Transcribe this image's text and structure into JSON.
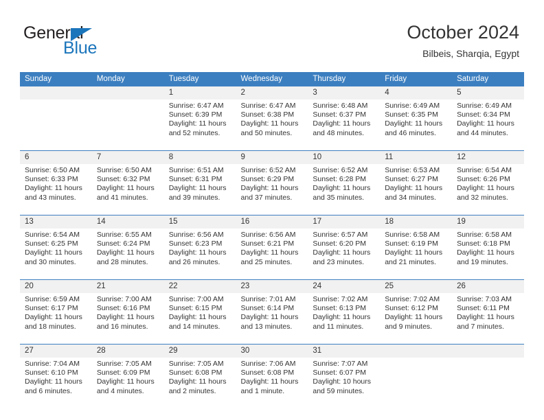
{
  "brand": {
    "name_top": "General",
    "name_bottom": "Blue",
    "flag_color": "#1b75bb"
  },
  "header": {
    "title": "October 2024",
    "location": "Bilbeis, Sharqia, Egypt",
    "header_bg": "#3c7fc0",
    "daynum_bg": "#f1f1f1"
  },
  "weekday_headers": [
    "Sunday",
    "Monday",
    "Tuesday",
    "Wednesday",
    "Thursday",
    "Friday",
    "Saturday"
  ],
  "weeks": [
    [
      {
        "day": "",
        "sunrise": "",
        "sunset": "",
        "daylight_l1": "",
        "daylight_l2": ""
      },
      {
        "day": "",
        "sunrise": "",
        "sunset": "",
        "daylight_l1": "",
        "daylight_l2": ""
      },
      {
        "day": "1",
        "sunrise": "Sunrise: 6:47 AM",
        "sunset": "Sunset: 6:39 PM",
        "daylight_l1": "Daylight: 11 hours",
        "daylight_l2": "and 52 minutes."
      },
      {
        "day": "2",
        "sunrise": "Sunrise: 6:47 AM",
        "sunset": "Sunset: 6:38 PM",
        "daylight_l1": "Daylight: 11 hours",
        "daylight_l2": "and 50 minutes."
      },
      {
        "day": "3",
        "sunrise": "Sunrise: 6:48 AM",
        "sunset": "Sunset: 6:37 PM",
        "daylight_l1": "Daylight: 11 hours",
        "daylight_l2": "and 48 minutes."
      },
      {
        "day": "4",
        "sunrise": "Sunrise: 6:49 AM",
        "sunset": "Sunset: 6:35 PM",
        "daylight_l1": "Daylight: 11 hours",
        "daylight_l2": "and 46 minutes."
      },
      {
        "day": "5",
        "sunrise": "Sunrise: 6:49 AM",
        "sunset": "Sunset: 6:34 PM",
        "daylight_l1": "Daylight: 11 hours",
        "daylight_l2": "and 44 minutes."
      }
    ],
    [
      {
        "day": "6",
        "sunrise": "Sunrise: 6:50 AM",
        "sunset": "Sunset: 6:33 PM",
        "daylight_l1": "Daylight: 11 hours",
        "daylight_l2": "and 43 minutes."
      },
      {
        "day": "7",
        "sunrise": "Sunrise: 6:50 AM",
        "sunset": "Sunset: 6:32 PM",
        "daylight_l1": "Daylight: 11 hours",
        "daylight_l2": "and 41 minutes."
      },
      {
        "day": "8",
        "sunrise": "Sunrise: 6:51 AM",
        "sunset": "Sunset: 6:31 PM",
        "daylight_l1": "Daylight: 11 hours",
        "daylight_l2": "and 39 minutes."
      },
      {
        "day": "9",
        "sunrise": "Sunrise: 6:52 AM",
        "sunset": "Sunset: 6:29 PM",
        "daylight_l1": "Daylight: 11 hours",
        "daylight_l2": "and 37 minutes."
      },
      {
        "day": "10",
        "sunrise": "Sunrise: 6:52 AM",
        "sunset": "Sunset: 6:28 PM",
        "daylight_l1": "Daylight: 11 hours",
        "daylight_l2": "and 35 minutes."
      },
      {
        "day": "11",
        "sunrise": "Sunrise: 6:53 AM",
        "sunset": "Sunset: 6:27 PM",
        "daylight_l1": "Daylight: 11 hours",
        "daylight_l2": "and 34 minutes."
      },
      {
        "day": "12",
        "sunrise": "Sunrise: 6:54 AM",
        "sunset": "Sunset: 6:26 PM",
        "daylight_l1": "Daylight: 11 hours",
        "daylight_l2": "and 32 minutes."
      }
    ],
    [
      {
        "day": "13",
        "sunrise": "Sunrise: 6:54 AM",
        "sunset": "Sunset: 6:25 PM",
        "daylight_l1": "Daylight: 11 hours",
        "daylight_l2": "and 30 minutes."
      },
      {
        "day": "14",
        "sunrise": "Sunrise: 6:55 AM",
        "sunset": "Sunset: 6:24 PM",
        "daylight_l1": "Daylight: 11 hours",
        "daylight_l2": "and 28 minutes."
      },
      {
        "day": "15",
        "sunrise": "Sunrise: 6:56 AM",
        "sunset": "Sunset: 6:23 PM",
        "daylight_l1": "Daylight: 11 hours",
        "daylight_l2": "and 26 minutes."
      },
      {
        "day": "16",
        "sunrise": "Sunrise: 6:56 AM",
        "sunset": "Sunset: 6:21 PM",
        "daylight_l1": "Daylight: 11 hours",
        "daylight_l2": "and 25 minutes."
      },
      {
        "day": "17",
        "sunrise": "Sunrise: 6:57 AM",
        "sunset": "Sunset: 6:20 PM",
        "daylight_l1": "Daylight: 11 hours",
        "daylight_l2": "and 23 minutes."
      },
      {
        "day": "18",
        "sunrise": "Sunrise: 6:58 AM",
        "sunset": "Sunset: 6:19 PM",
        "daylight_l1": "Daylight: 11 hours",
        "daylight_l2": "and 21 minutes."
      },
      {
        "day": "19",
        "sunrise": "Sunrise: 6:58 AM",
        "sunset": "Sunset: 6:18 PM",
        "daylight_l1": "Daylight: 11 hours",
        "daylight_l2": "and 19 minutes."
      }
    ],
    [
      {
        "day": "20",
        "sunrise": "Sunrise: 6:59 AM",
        "sunset": "Sunset: 6:17 PM",
        "daylight_l1": "Daylight: 11 hours",
        "daylight_l2": "and 18 minutes."
      },
      {
        "day": "21",
        "sunrise": "Sunrise: 7:00 AM",
        "sunset": "Sunset: 6:16 PM",
        "daylight_l1": "Daylight: 11 hours",
        "daylight_l2": "and 16 minutes."
      },
      {
        "day": "22",
        "sunrise": "Sunrise: 7:00 AM",
        "sunset": "Sunset: 6:15 PM",
        "daylight_l1": "Daylight: 11 hours",
        "daylight_l2": "and 14 minutes."
      },
      {
        "day": "23",
        "sunrise": "Sunrise: 7:01 AM",
        "sunset": "Sunset: 6:14 PM",
        "daylight_l1": "Daylight: 11 hours",
        "daylight_l2": "and 13 minutes."
      },
      {
        "day": "24",
        "sunrise": "Sunrise: 7:02 AM",
        "sunset": "Sunset: 6:13 PM",
        "daylight_l1": "Daylight: 11 hours",
        "daylight_l2": "and 11 minutes."
      },
      {
        "day": "25",
        "sunrise": "Sunrise: 7:02 AM",
        "sunset": "Sunset: 6:12 PM",
        "daylight_l1": "Daylight: 11 hours",
        "daylight_l2": "and 9 minutes."
      },
      {
        "day": "26",
        "sunrise": "Sunrise: 7:03 AM",
        "sunset": "Sunset: 6:11 PM",
        "daylight_l1": "Daylight: 11 hours",
        "daylight_l2": "and 7 minutes."
      }
    ],
    [
      {
        "day": "27",
        "sunrise": "Sunrise: 7:04 AM",
        "sunset": "Sunset: 6:10 PM",
        "daylight_l1": "Daylight: 11 hours",
        "daylight_l2": "and 6 minutes."
      },
      {
        "day": "28",
        "sunrise": "Sunrise: 7:05 AM",
        "sunset": "Sunset: 6:09 PM",
        "daylight_l1": "Daylight: 11 hours",
        "daylight_l2": "and 4 minutes."
      },
      {
        "day": "29",
        "sunrise": "Sunrise: 7:05 AM",
        "sunset": "Sunset: 6:08 PM",
        "daylight_l1": "Daylight: 11 hours",
        "daylight_l2": "and 2 minutes."
      },
      {
        "day": "30",
        "sunrise": "Sunrise: 7:06 AM",
        "sunset": "Sunset: 6:08 PM",
        "daylight_l1": "Daylight: 11 hours",
        "daylight_l2": "and 1 minute."
      },
      {
        "day": "31",
        "sunrise": "Sunrise: 7:07 AM",
        "sunset": "Sunset: 6:07 PM",
        "daylight_l1": "Daylight: 10 hours",
        "daylight_l2": "and 59 minutes."
      },
      {
        "day": "",
        "sunrise": "",
        "sunset": "",
        "daylight_l1": "",
        "daylight_l2": ""
      },
      {
        "day": "",
        "sunrise": "",
        "sunset": "",
        "daylight_l1": "",
        "daylight_l2": ""
      }
    ]
  ]
}
